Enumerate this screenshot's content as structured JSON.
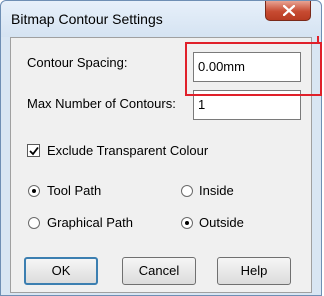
{
  "window": {
    "title": "Bitmap Contour Settings",
    "close_icon": "close-icon"
  },
  "fields": {
    "contour_spacing_label": "Contour Spacing:",
    "contour_spacing_value": "0.00mm",
    "max_contours_label": "Max Number of Contours:",
    "max_contours_value": "1"
  },
  "options": {
    "exclude_transparent_label": "Exclude Transparent Colour",
    "exclude_transparent_checked": true,
    "tool_path_label": "Tool Path",
    "tool_path_selected": true,
    "graphical_path_label": "Graphical Path",
    "graphical_path_selected": false,
    "inside_label": "Inside",
    "inside_selected": false,
    "outside_label": "Outside",
    "outside_selected": true
  },
  "buttons": {
    "ok_label": "OK",
    "cancel_label": "Cancel",
    "help_label": "Help"
  },
  "colors": {
    "annotation_highlight": "#e0202a",
    "default_button_border": "#3c7fb1"
  }
}
